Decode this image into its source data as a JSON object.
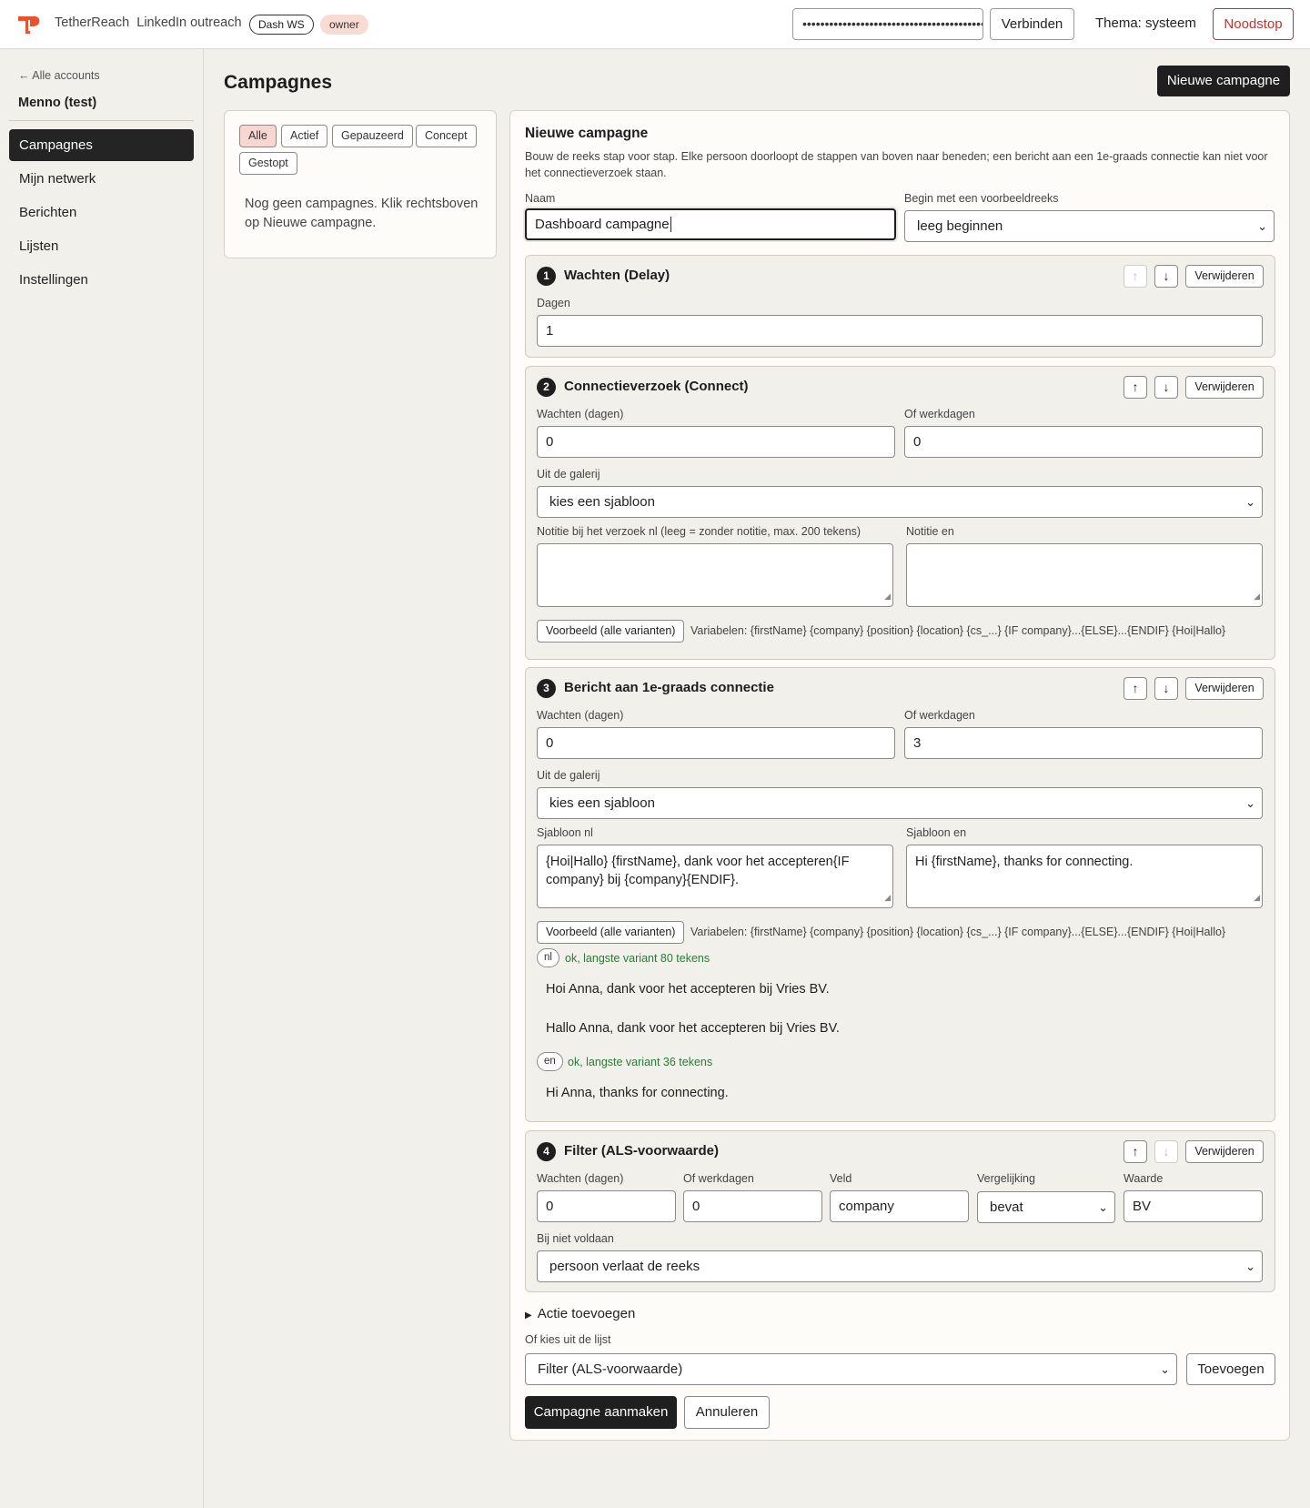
{
  "header": {
    "brand": "TetherReach",
    "subtitle": "LinkedIn outreach",
    "workspace_badge": "Dash WS",
    "role_badge": "owner",
    "api_key_value": "••••••••••••••••••••••••••••••••••••••••••",
    "connect_label": "Verbinden",
    "theme_label": "Thema: systeem",
    "emergency_stop_label": "Noodstop",
    "colors": {
      "accent": "#e8522f",
      "danger": "#c7302a"
    }
  },
  "sidebar": {
    "back_link": "← Alle accounts",
    "account_name": "Menno (test)",
    "items": [
      {
        "label": "Campagnes",
        "active": true
      },
      {
        "label": "Mijn netwerk",
        "active": false
      },
      {
        "label": "Berichten",
        "active": false
      },
      {
        "label": "Lijsten",
        "active": false
      },
      {
        "label": "Instellingen",
        "active": false
      }
    ]
  },
  "main": {
    "page_title": "Campagnes",
    "new_campaign_button": "Nieuwe campagne",
    "filters": [
      "Alle",
      "Actief",
      "Gepauzeerd",
      "Concept",
      "Gestopt"
    ],
    "active_filter": "Alle",
    "empty_text": "Nog geen campagnes. Klik rechtsboven op Nieuwe campagne."
  },
  "form": {
    "title": "Nieuwe campagne",
    "description": "Bouw de reeks stap voor stap. Elke persoon doorloopt de stappen van boven naar beneden; een bericht aan een 1e-graads connectie kan niet voor het connectieverzoek staan.",
    "name_label": "Naam",
    "name_value": "Dashboard campagne",
    "template_label": "Begin met een voorbeeldreeks",
    "template_value": "leeg beginnen",
    "delete_label": "Verwijderen",
    "up_arrow": "↑",
    "down_arrow": "↓",
    "preview_button": "Voorbeeld (alle varianten)",
    "variables_text": "Variabelen: {firstName} {company} {position} {location} {cs_...} {IF company}...{ELSE}...{ENDIF} {Hoi|Hallo}",
    "steps": [
      {
        "number": "1",
        "title": "Wachten (Delay)",
        "days_label": "Dagen",
        "days_value": "1"
      },
      {
        "number": "2",
        "title": "Connectieverzoek (Connect)",
        "wait_label": "Wachten (dagen)",
        "wait_value": "0",
        "workdays_label": "Of werkdagen",
        "workdays_value": "0",
        "gallery_label": "Uit de galerij",
        "gallery_value": "kies een sjabloon",
        "note_nl_label": "Notitie bij het verzoek nl (leeg = zonder notitie, max. 200 tekens)",
        "note_nl_value": "",
        "note_en_label": "Notitie en",
        "note_en_value": ""
      },
      {
        "number": "3",
        "title": "Bericht aan 1e-graads connectie",
        "wait_label": "Wachten (dagen)",
        "wait_value": "0",
        "workdays_label": "Of werkdagen",
        "workdays_value": "3",
        "gallery_label": "Uit de galerij",
        "gallery_value": "kies een sjabloon",
        "tpl_nl_label": "Sjabloon nl",
        "tpl_nl_value": "{Hoi|Hallo} {firstName}, dank voor het accepteren{IF company} bij {company}{ENDIF}.",
        "tpl_en_label": "Sjabloon en",
        "tpl_en_value": "Hi {firstName}, thanks for connecting.",
        "nl_badge": "nl",
        "nl_status": "ok, langste variant 80 tekens",
        "nl_previews": [
          "Hoi Anna, dank voor het accepteren bij Vries BV.",
          "Hallo Anna, dank voor het accepteren bij Vries BV."
        ],
        "en_badge": "en",
        "en_status": "ok, langste variant 36 tekens",
        "en_previews": [
          "Hi Anna, thanks for connecting."
        ]
      },
      {
        "number": "4",
        "title": "Filter (ALS-voorwaarde)",
        "wait_label": "Wachten (dagen)",
        "wait_value": "0",
        "workdays_label": "Of werkdagen",
        "workdays_value": "0",
        "field_label": "Veld",
        "field_value": "company",
        "compare_label": "Vergelijking",
        "compare_value": "bevat",
        "value_label": "Waarde",
        "value_value": "BV",
        "unmet_label": "Bij niet voldaan",
        "unmet_value": "persoon verlaat de reeks"
      }
    ],
    "add_action_label": "Actie toevoegen",
    "pick_label": "Of kies uit de lijst",
    "pick_value": "Filter (ALS-voorwaarde)",
    "add_button": "Toevoegen",
    "create_button": "Campagne aanmaken",
    "cancel_button": "Annuleren"
  }
}
